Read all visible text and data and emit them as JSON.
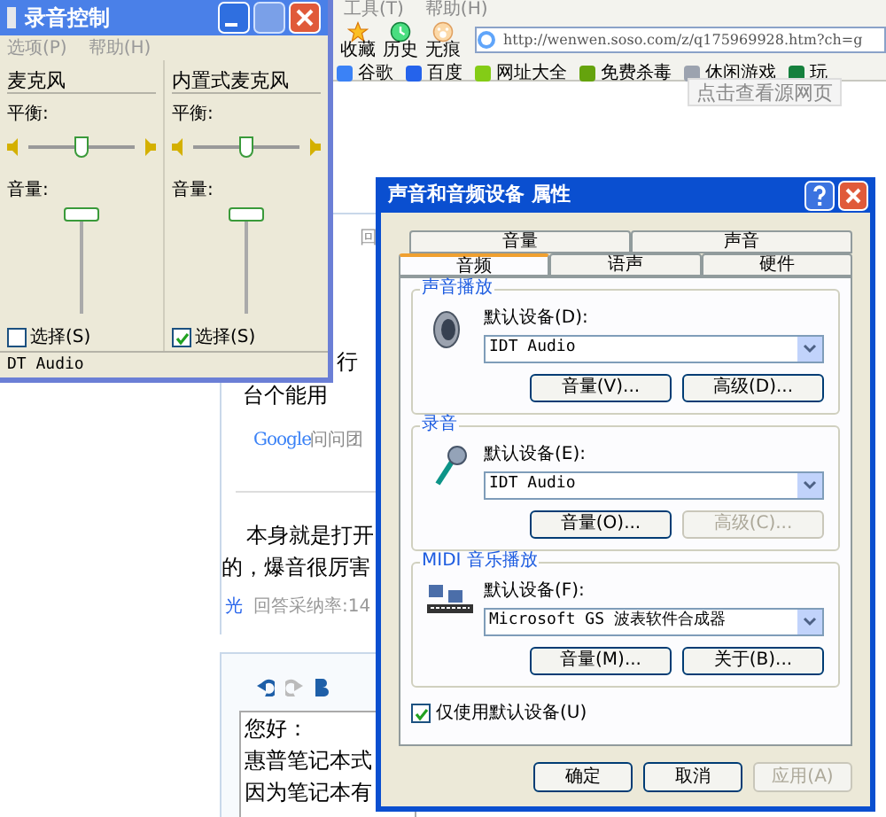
{
  "browser": {
    "menu": [
      "工具(T)",
      "帮助(H)"
    ],
    "toolbar": [
      {
        "label": "收藏",
        "kind": "star"
      },
      {
        "label": "历史",
        "kind": "history"
      },
      {
        "label": "无痕",
        "kind": "paw"
      }
    ],
    "address": "http://wenwen.soso.com/z/q175969928.htm?ch=g",
    "tooltip": "点击查看源网页",
    "links": [
      {
        "label": "谷歌",
        "color": "#3b82f6"
      },
      {
        "label": "百度",
        "color": "#2563eb"
      },
      {
        "label": "网址大全",
        "color": "#84cc16"
      },
      {
        "label": "免费杀毒",
        "color": "#65a30d"
      },
      {
        "label": "休闲游戏",
        "color": "#9ca3af"
      },
      {
        "label": "玩",
        "color": "#15803d"
      }
    ]
  },
  "page": {
    "tab": "回",
    "lines_top": [
      "行",
      "台个能用"
    ],
    "logo": "Google",
    "team": "问问团",
    "answer": [
      "本身就是打开",
      "的，爆音很厉害"
    ],
    "answerer": {
      "name": "光",
      "rate": "回答采纳率:14"
    },
    "editor_lines": [
      "您好：",
      "惠普笔记本式",
      "因为笔记本有"
    ]
  },
  "recording_control": {
    "title": "录音控制",
    "menu": [
      "选项(P)",
      "帮助(H)"
    ],
    "channels": [
      {
        "name": "麦克风",
        "balance_label": "平衡:",
        "balance": {
          "level": 0.5
        },
        "volume_label": "音量:",
        "volume": {
          "level": 1
        },
        "select": {
          "label": "选择(S)",
          "checked": false
        }
      },
      {
        "name": "内置式麦克风",
        "balance_label": "平衡:",
        "balance": {
          "level": 0.5
        },
        "volume_label": "音量:",
        "volume": {
          "level": 1
        },
        "select": {
          "label": "选择(S)",
          "checked": true
        }
      }
    ],
    "status_bar": "DT Audio"
  },
  "dialog": {
    "title": "声音和音频设备 属性",
    "tabs_back": [
      {
        "label": "音量",
        "selected": false
      },
      {
        "label": "声音",
        "selected": false
      }
    ],
    "tabs_front": [
      {
        "label": "音频",
        "selected": true
      },
      {
        "label": "语声",
        "selected": false
      },
      {
        "label": "硬件",
        "selected": false
      }
    ],
    "groups": [
      {
        "title": "声音播放",
        "kind": "speaker",
        "device_label": "默认设备(D):",
        "device": "IDT Audio",
        "buttons": [
          {
            "label": "音量(V)...",
            "disabled": false
          },
          {
            "label": "高级(D)...",
            "disabled": false
          }
        ]
      },
      {
        "title": "录音",
        "kind": "microphone",
        "device_label": "默认设备(E):",
        "device": "IDT Audio",
        "buttons": [
          {
            "label": "音量(O)...",
            "disabled": false
          },
          {
            "label": "高级(C)...",
            "disabled": true
          }
        ]
      },
      {
        "title": "MIDI 音乐播放",
        "kind": "midi",
        "device_label": "默认设备(F):",
        "device": "Microsoft GS 波表软件合成器",
        "buttons": [
          {
            "label": "音量(M)...",
            "disabled": false
          },
          {
            "label": "关于(B)...",
            "disabled": false
          }
        ]
      }
    ],
    "only_default": {
      "label": "仅使用默认设备(U)",
      "checked": true
    },
    "buttons": [
      {
        "label": "确定",
        "disabled": false
      },
      {
        "label": "取消",
        "disabled": false
      },
      {
        "label": "应用(A)",
        "disabled": true
      }
    ]
  }
}
